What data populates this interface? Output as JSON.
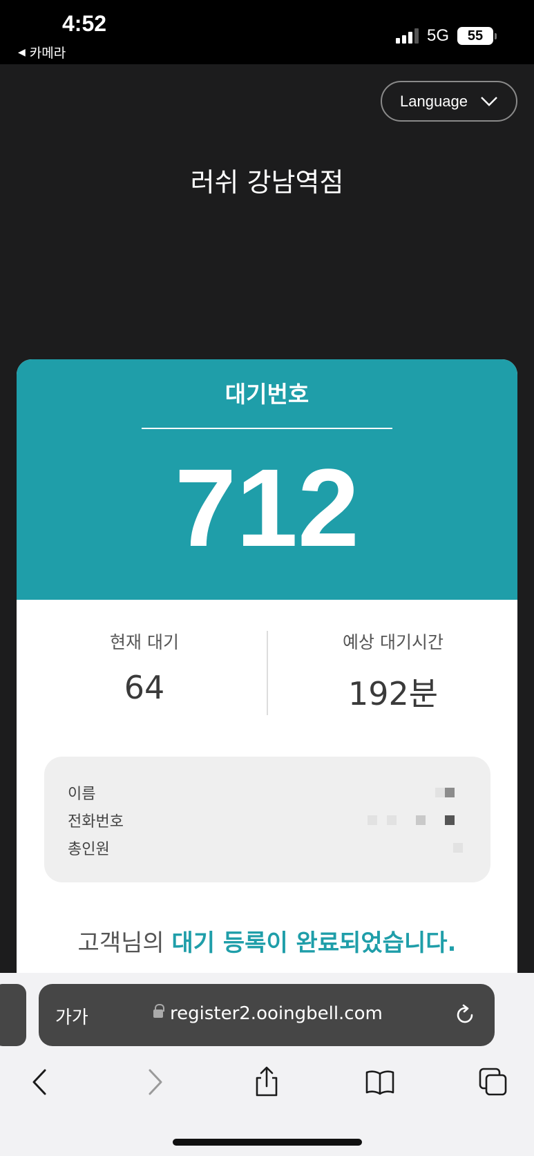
{
  "status_bar": {
    "time": "4:52",
    "back_app": "카메라",
    "network": "5G",
    "battery": "55"
  },
  "header": {
    "language_label": "Language",
    "store_name": "러쉬 강남역점"
  },
  "ticket": {
    "label": "대기번호",
    "number": "712"
  },
  "stats": {
    "current_wait_label": "현재 대기",
    "current_wait_value": "64",
    "expected_time_label": "예상 대기시간",
    "expected_time_value": "192분"
  },
  "info": {
    "name_label": "이름",
    "phone_label": "전화번호",
    "party_label": "총인원"
  },
  "message": {
    "prefix": "고객님의 ",
    "highlight": "대기 등록이 완료되었습니다."
  },
  "browser": {
    "text_size_label": "가가",
    "url": "register2.ooingbell.com"
  },
  "colors": {
    "accent": "#1f9ea9",
    "page_background": "#1c1c1d",
    "url_bar": "#464646"
  }
}
